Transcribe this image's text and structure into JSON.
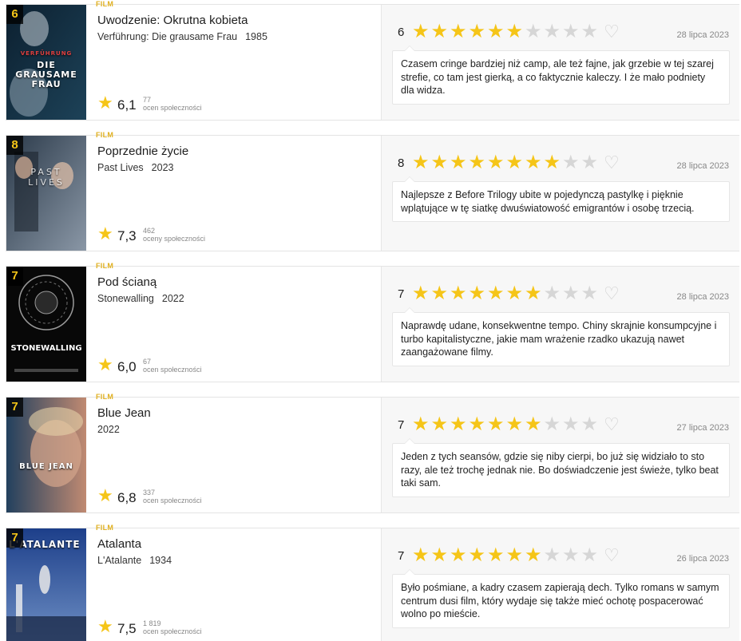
{
  "type_label": "FILM",
  "star_glyph": "★",
  "heart_glyph": "♡",
  "items": [
    {
      "rank": "6",
      "title": "Uwodzenie: Okrutna kobieta",
      "original_title": "Verführung: Die grausame Frau",
      "year": "1985",
      "community_rating": "6,1",
      "community_count": "77",
      "community_label": "ocen społeczności",
      "user_rating": "6",
      "user_stars": 6,
      "date": "28 lipca 2023",
      "review": "Czasem cringe bardziej niż camp, ale też fajne, jak grzebie w tej szarej strefie, co tam jest gierką, a co faktycznie kaleczy. I że mało podniety dla widza.",
      "poster_lines": [
        "VERFÜHRUNG",
        "DIE",
        "GRAUSAME",
        "FRAU"
      ],
      "poster_colors": [
        "#0c2030",
        "#1d4258"
      ]
    },
    {
      "rank": "8",
      "title": "Poprzednie życie",
      "original_title": "Past Lives",
      "year": "2023",
      "community_rating": "7,3",
      "community_count": "462",
      "community_label": "oceny społeczności",
      "user_rating": "8",
      "user_stars": 8,
      "date": "28 lipca 2023",
      "review": "Najlepsze z Before Trilogy ubite w pojedynczą pastylkę i pięknie wplątujące w tę siatkę dwuświatowość emigrantów i osobę trzecią.",
      "poster_lines": [
        "PAST",
        "LIVES"
      ],
      "poster_colors": [
        "#2b3a4a",
        "#8a97a6"
      ]
    },
    {
      "rank": "7",
      "title": "Pod ścianą",
      "original_title": "Stonewalling",
      "year": "2022",
      "community_rating": "6,0",
      "community_count": "67",
      "community_label": "ocen społeczności",
      "user_rating": "7",
      "user_stars": 7,
      "date": "28 lipca 2023",
      "review": "Naprawdę udane, konsekwentne tempo. Chiny skrajnie konsumpcyjne i turbo kapitalistyczne, jakie mam wrażenie rzadko ukazują nawet zaangażowane filmy.",
      "poster_lines": [
        "STONEWALLING"
      ],
      "poster_colors": [
        "#050505",
        "#1c1c1c"
      ]
    },
    {
      "rank": "7",
      "title": "Blue Jean",
      "original_title": "",
      "year": "2022",
      "community_rating": "6,8",
      "community_count": "337",
      "community_label": "ocen społeczności",
      "user_rating": "7",
      "user_stars": 7,
      "date": "27 lipca 2023",
      "review": "Jeden z tych seansów, gdzie się niby cierpi, bo już się widziało to sto razy, ale też trochę jednak nie. Bo doświadczenie jest świeże, tylko beat taki sam.",
      "poster_lines": [
        "BLUE JEAN"
      ],
      "poster_colors": [
        "#22405e",
        "#c08a72"
      ]
    },
    {
      "rank": "7",
      "title": "Atalanta",
      "original_title": "L'Atalante",
      "year": "1934",
      "community_rating": "7,5",
      "community_count": "1 819",
      "community_label": "ocen społeczności",
      "user_rating": "7",
      "user_stars": 7,
      "date": "26 lipca 2023",
      "review": "Było pośmiane, a kadry czasem zapierają dech. Tylko romans w samym centrum dusi film, który wydaje się także mieć ochotę pospacerować wolno po mieście.",
      "poster_lines": [
        "L'ATALANTE"
      ],
      "poster_colors": [
        "#1d3f8a",
        "#6e8fc4"
      ]
    }
  ]
}
